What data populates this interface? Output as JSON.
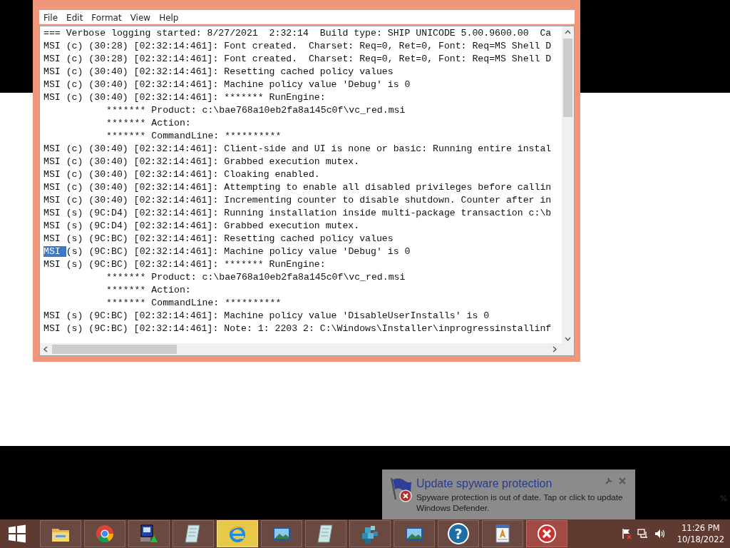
{
  "window": {
    "menu": [
      "File",
      "Edit",
      "Format",
      "View",
      "Help"
    ]
  },
  "lines": [
    {
      "kind": "log",
      "text": "=== Verbose logging started: 8/27/2021  2:32:14  Build type: SHIP UNICODE 5.00.9600.00  Ca"
    },
    {
      "kind": "log",
      "text": "MSI (c) (30:28) [02:32:14:461]: Font created.  Charset: Req=0, Ret=0, Font: Req=MS Shell D"
    },
    {
      "kind": "log",
      "text": "MSI (c) (30:28) [02:32:14:461]: Font created.  Charset: Req=0, Ret=0, Font: Req=MS Shell D"
    },
    {
      "kind": "log",
      "text": "MSI (c) (30:40) [02:32:14:461]: Resetting cached policy values"
    },
    {
      "kind": "log",
      "text": "MSI (c) (30:40) [02:32:14:461]: Machine policy value 'Debug' is 0"
    },
    {
      "kind": "log",
      "text": "MSI (c) (30:40) [02:32:14:461]: ******* RunEngine:"
    },
    {
      "kind": "continuation",
      "text": "******* Product: c:\\bae768a10eb2fa8a145c0f\\vc_red.msi"
    },
    {
      "kind": "continuation",
      "text": "******* Action:"
    },
    {
      "kind": "continuation",
      "text": "******* CommandLine: **********"
    },
    {
      "kind": "log",
      "text": "MSI (c) (30:40) [02:32:14:461]: Client-side and UI is none or basic: Running entire instal"
    },
    {
      "kind": "log",
      "text": "MSI (c) (30:40) [02:32:14:461]: Grabbed execution mutex."
    },
    {
      "kind": "log",
      "text": "MSI (c) (30:40) [02:32:14:461]: Cloaking enabled."
    },
    {
      "kind": "log",
      "text": "MSI (c) (30:40) [02:32:14:461]: Attempting to enable all disabled privileges before callin"
    },
    {
      "kind": "log",
      "text": "MSI (c) (30:40) [02:32:14:461]: Incrementing counter to disable shutdown. Counter after in"
    },
    {
      "kind": "log",
      "text": "MSI (s) (9C:D4) [02:32:14:461]: Running installation inside multi-package transaction c:\\b"
    },
    {
      "kind": "log",
      "text": "MSI (s) (9C:D4) [02:32:14:461]: Grabbed execution mutex."
    },
    {
      "kind": "log",
      "text": "MSI (s) (9C:BC) [02:32:14:461]: Resetting cached policy values"
    },
    {
      "kind": "log",
      "selection": "MSI",
      "text": "(s) (9C:BC) [02:32:14:461]: Machine policy value 'Debug' is 0"
    },
    {
      "kind": "log",
      "text": "MSI (s) (9C:BC) [02:32:14:461]: ******* RunEngine:"
    },
    {
      "kind": "continuation",
      "text": "******* Product: c:\\bae768a10eb2fa8a145c0f\\vc_red.msi"
    },
    {
      "kind": "continuation",
      "text": "******* Action:"
    },
    {
      "kind": "continuation",
      "text": "******* CommandLine: **********"
    },
    {
      "kind": "log",
      "text": "MSI (s) (9C:BC) [02:32:14:461]: Machine policy value 'DisableUserInstalls' is 0"
    },
    {
      "kind": "log",
      "text": "MSI (s) (9C:BC) [02:32:14:461]: Note: 1: 2203 2: C:\\Windows\\Installer\\inprogressinstallinf"
    }
  ],
  "notification": {
    "title": "Update spyware protection",
    "message": "Spyware protection is out of date. Tap or click to update Windows Defender."
  },
  "desktop_fragment": "%",
  "taskbar": {
    "items": [
      {
        "kind": "folder",
        "active": false
      },
      {
        "kind": "chrome",
        "active": false
      },
      {
        "kind": "installer",
        "active": false
      },
      {
        "kind": "notepad",
        "active": false
      },
      {
        "kind": "ie",
        "active": true
      },
      {
        "kind": "photo",
        "active": false
      },
      {
        "kind": "notepad",
        "active": false
      },
      {
        "kind": "cubes",
        "active": false
      },
      {
        "kind": "photo",
        "active": false
      },
      {
        "kind": "help",
        "glyph": "?",
        "active": false
      },
      {
        "kind": "wordpad",
        "active": false
      },
      {
        "kind": "error",
        "active": false
      }
    ],
    "time": "11:26 PM",
    "date": "10/18/2022"
  }
}
